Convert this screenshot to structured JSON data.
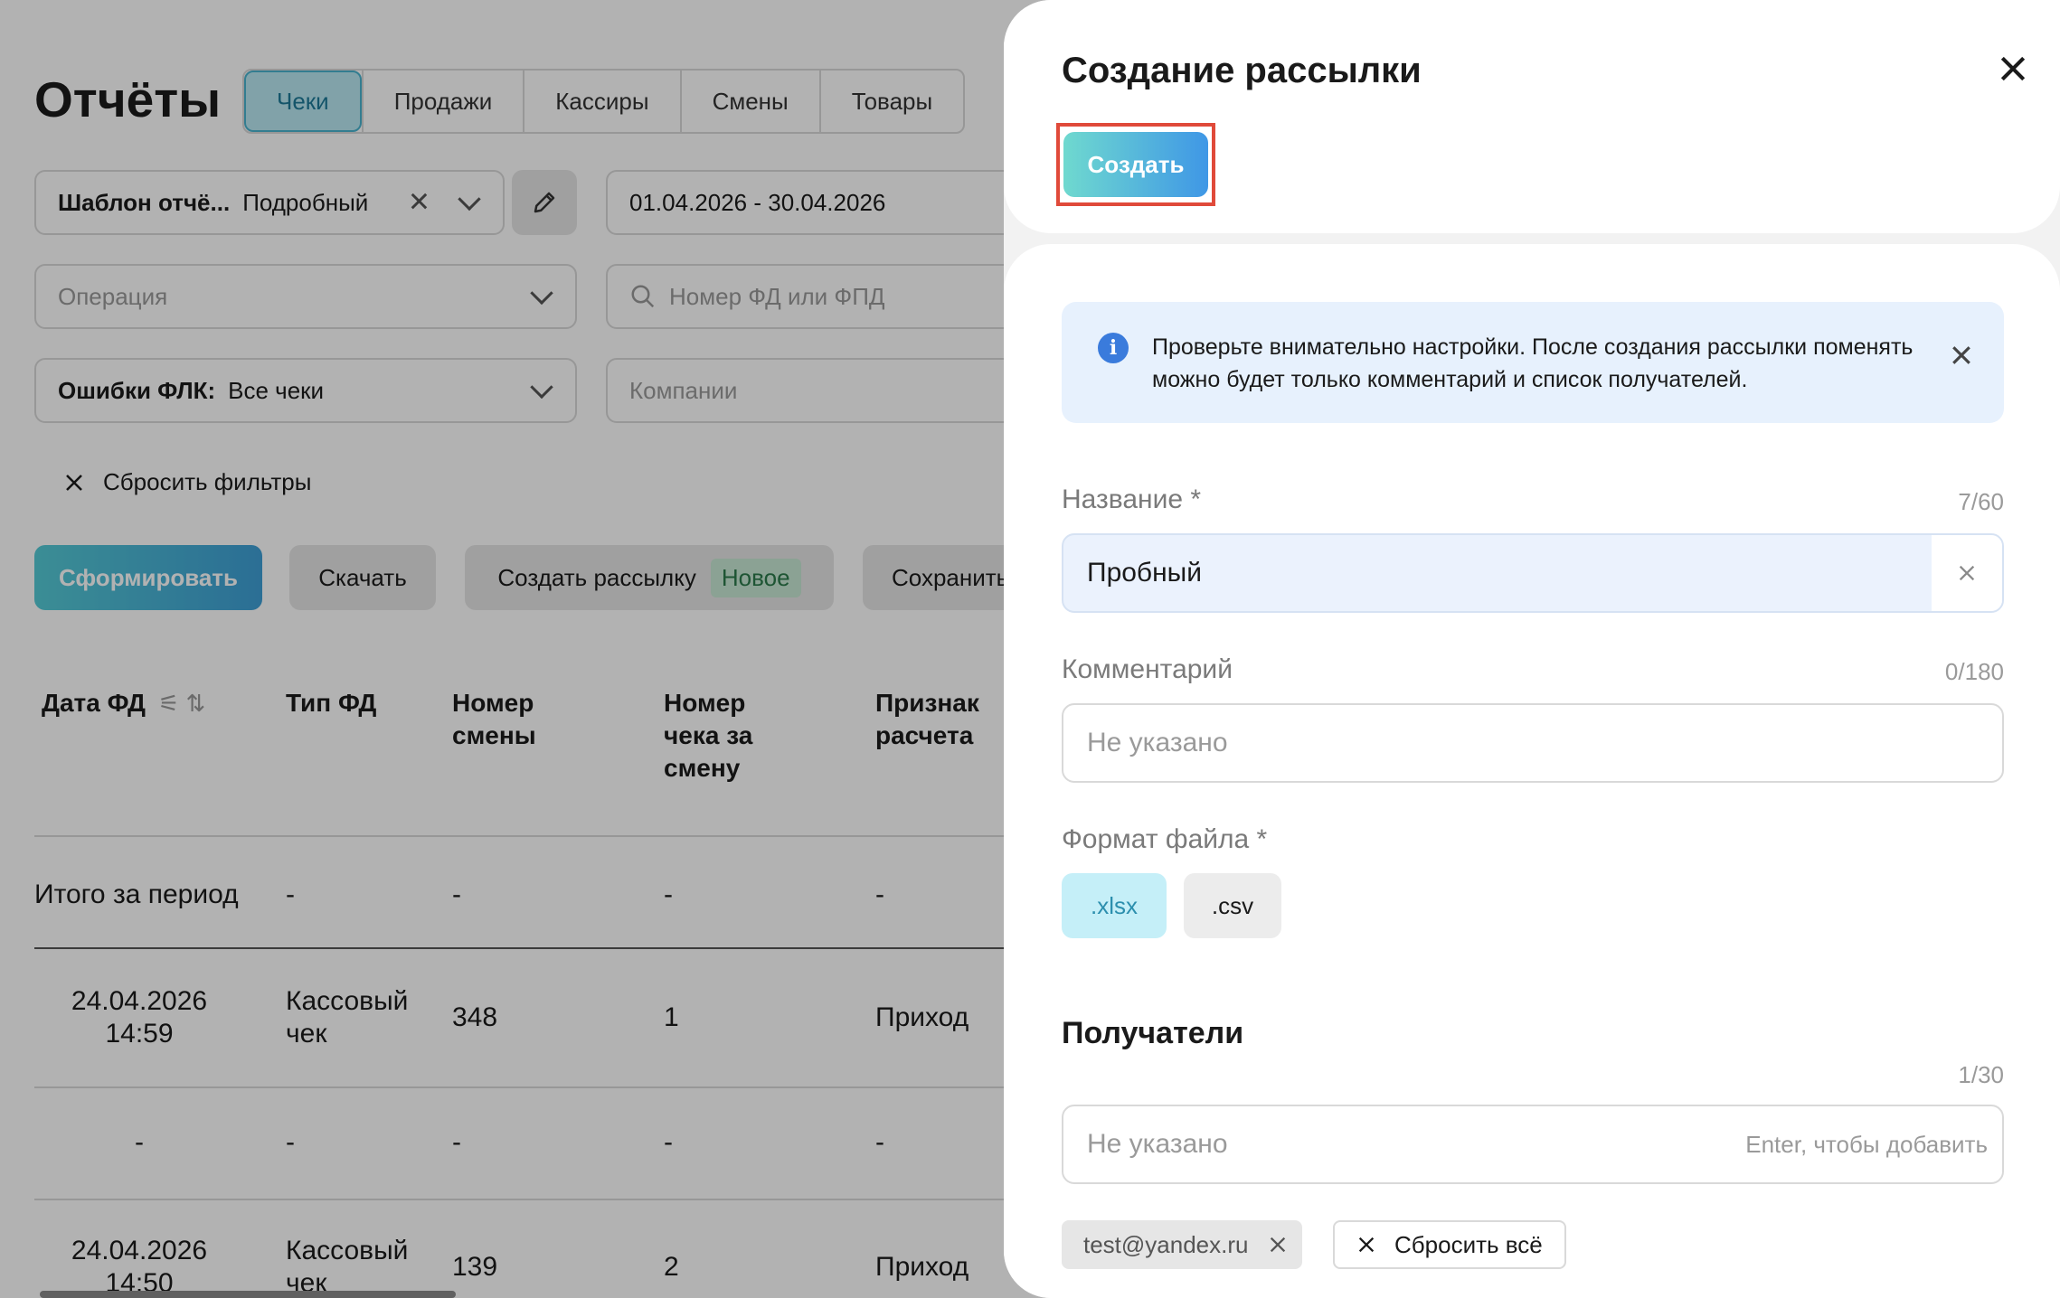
{
  "page": {
    "title": "Отчёты",
    "tabs": [
      "Чеки",
      "Продажи",
      "Кассиры",
      "Смены",
      "Товары"
    ],
    "filters": {
      "template_label": "Шаблон отчё...",
      "template_value": "Подробный",
      "date_range": "01.04.2026 - 30.04.2026",
      "operation_placeholder": "Операция",
      "search_placeholder": "Номер ФД или ФПД",
      "flk_label": "Ошибки ФЛК:",
      "flk_value": "Все чеки",
      "companies_placeholder": "Компании",
      "reset_filters": "Сбросить фильтры"
    },
    "actions": {
      "generate": "Сформировать",
      "download": "Скачать",
      "create_mailing": "Создать рассылку",
      "new_badge": "Новое",
      "save": "Сохранить"
    },
    "table": {
      "headers": [
        "Дата ФД",
        "Тип ФД",
        "Номер смены",
        "Номер чека за смену",
        "Признак расчета"
      ],
      "total_label": "Итого за период",
      "total_values": [
        "-",
        "-",
        "-",
        "-"
      ],
      "rows": [
        {
          "date": "24.04.2026",
          "time": "14:59",
          "type_line1": "Кассовый",
          "type_line2": "чек",
          "shift": "348",
          "receipt": "1",
          "sign": "Приход"
        },
        {
          "date": "-",
          "time": "",
          "type_line1": "-",
          "type_line2": "",
          "shift": "-",
          "receipt": "-",
          "sign": "-"
        },
        {
          "date": "24.04.2026",
          "time": "14:50",
          "type_line1": "Кассовый",
          "type_line2": "чек",
          "shift": "139",
          "receipt": "2",
          "sign": "Приход"
        }
      ]
    }
  },
  "drawer": {
    "title": "Создание рассылки",
    "create_button": "Создать",
    "info_text": "Проверьте внимательно настройки. После создания рассылки поменять можно будет только комментарий и список получателей.",
    "name_label": "Название *",
    "name_counter": "7/60",
    "name_value": "Пробный",
    "comment_label": "Комментарий",
    "comment_counter": "0/180",
    "comment_placeholder": "Не указано",
    "format_label": "Формат файла *",
    "formats": [
      ".xlsx",
      ".csv"
    ],
    "selected_format": ".xlsx",
    "recipients_title": "Получатели",
    "recipients_counter": "1/30",
    "recipients_placeholder": "Не указано",
    "recipients_hint": "Enter, чтобы добавить",
    "recipients": [
      "test@yandex.ru"
    ],
    "reset_all": "Сбросить всё"
  },
  "colors": {
    "accent_teal": "#4ab3cf",
    "primary_gradient_start": "#55cbd6",
    "primary_gradient_end": "#3e9fd6",
    "highlight_outline": "#e04a3a",
    "info_bg": "#e7f1fd",
    "info_icon": "#3a7bdc"
  }
}
